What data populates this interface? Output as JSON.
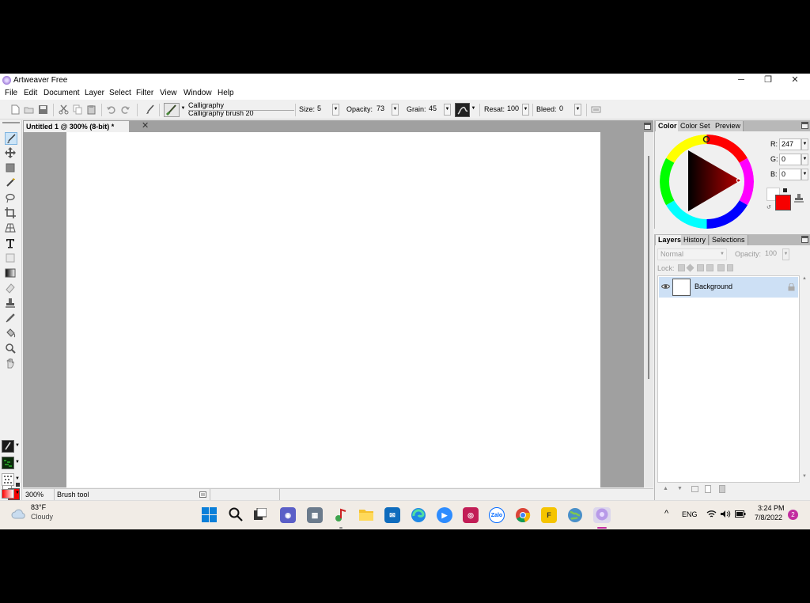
{
  "window": {
    "title": "Artweaver Free",
    "minimize": "─",
    "restore": "❐",
    "close": "✕"
  },
  "menu": [
    "File",
    "Edit",
    "Document",
    "Layer",
    "Select",
    "Filter",
    "View",
    "Window",
    "Help"
  ],
  "toolbar": {
    "brush_category": "Calligraphy",
    "brush_name": "Calligraphy brush 20",
    "size_label": "Size:",
    "size_value": "5",
    "opacity_label": "Opacity:",
    "opacity_value": "73",
    "grain_label": "Grain:",
    "grain_value": "45",
    "resat_label": "Resat:",
    "resat_value": "100",
    "bleed_label": "Bleed:",
    "bleed_value": "0"
  },
  "document": {
    "tab_title": "Untitled 1 @ 300% (8-bit) *",
    "close": "✕"
  },
  "status": {
    "zoom": "300%",
    "tool": "Brush tool"
  },
  "color_panel": {
    "tabs": [
      "Color",
      "Color Set",
      "Preview"
    ],
    "r_label": "R:",
    "r_value": "247",
    "g_label": "G:",
    "g_value": "0",
    "b_label": "B:",
    "b_value": "0",
    "foreground": "#f70000",
    "background": "#ffffff"
  },
  "layers_panel": {
    "tabs": [
      "Layers",
      "History",
      "Selections"
    ],
    "blend_mode": "Normal",
    "opacity_label": "Opacity:",
    "opacity_value": "100",
    "lock_label": "Lock:",
    "layers": [
      {
        "name": "Background"
      }
    ]
  },
  "taskbar": {
    "weather_temp": "83°F",
    "weather_desc": "Cloudy",
    "language": "ENG",
    "time": "3:24 PM",
    "date": "7/8/2022",
    "notifications": "2",
    "zalo": "Zalo",
    "f_app": "F"
  }
}
